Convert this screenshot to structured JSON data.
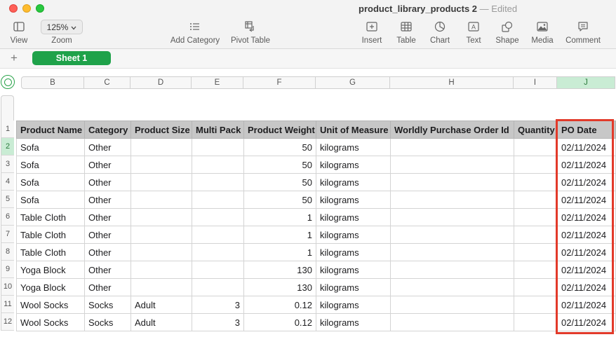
{
  "window": {
    "title": "product_library_products 2",
    "status": "— Edited"
  },
  "toolbar": {
    "view_label": "View",
    "zoom_value": "125%",
    "zoom_label": "Zoom",
    "add_category_label": "Add Category",
    "pivot_table_label": "Pivot Table",
    "insert_label": "Insert",
    "table_label": "Table",
    "chart_label": "Chart",
    "text_label": "Text",
    "shape_label": "Shape",
    "media_label": "Media",
    "comment_label": "Comment"
  },
  "sheets": {
    "add_symbol": "+",
    "active": "Sheet 1"
  },
  "columns": [
    "B",
    "C",
    "D",
    "E",
    "F",
    "G",
    "H",
    "I",
    "J"
  ],
  "selected_column": "J",
  "rows": {
    "numbers": [
      "1",
      "2",
      "3",
      "4",
      "5",
      "6",
      "7",
      "8",
      "9",
      "10",
      "11",
      "12"
    ],
    "selected_row": "2"
  },
  "table": {
    "headers": [
      "Product Name",
      "Category",
      "Product Size",
      "Multi Pack",
      "Product Weight",
      "Unit of Measure",
      "Worldly Purchase Order Id",
      "Quantity",
      "PO Date"
    ],
    "rows": [
      [
        "Sofa",
        "Other",
        "",
        "",
        "50",
        "kilograms",
        "",
        "",
        "02/11/2024"
      ],
      [
        "Sofa",
        "Other",
        "",
        "",
        "50",
        "kilograms",
        "",
        "",
        "02/11/2024"
      ],
      [
        "Sofa",
        "Other",
        "",
        "",
        "50",
        "kilograms",
        "",
        "",
        "02/11/2024"
      ],
      [
        "Sofa",
        "Other",
        "",
        "",
        "50",
        "kilograms",
        "",
        "",
        "02/11/2024"
      ],
      [
        "Table Cloth",
        "Other",
        "",
        "",
        "1",
        "kilograms",
        "",
        "",
        "02/11/2024"
      ],
      [
        "Table Cloth",
        "Other",
        "",
        "",
        "1",
        "kilograms",
        "",
        "",
        "02/11/2024"
      ],
      [
        "Table Cloth",
        "Other",
        "",
        "",
        "1",
        "kilograms",
        "",
        "",
        "02/11/2024"
      ],
      [
        "Yoga Block",
        "Other",
        "",
        "",
        "130",
        "kilograms",
        "",
        "",
        "02/11/2024"
      ],
      [
        "Yoga Block",
        "Other",
        "",
        "",
        "130",
        "kilograms",
        "",
        "",
        "02/11/2024"
      ],
      [
        "Wool Socks",
        "Socks",
        "Adult",
        "3",
        "0.12",
        "kilograms",
        "",
        "",
        "02/11/2024"
      ],
      [
        "Wool Socks",
        "Socks",
        "Adult",
        "3",
        "0.12",
        "kilograms",
        "",
        "",
        "02/11/2024"
      ]
    ]
  },
  "colors": {
    "accent_green": "#1fa24a",
    "highlight_red": "#e23a2a",
    "header_gray": "#c7c7c7"
  }
}
